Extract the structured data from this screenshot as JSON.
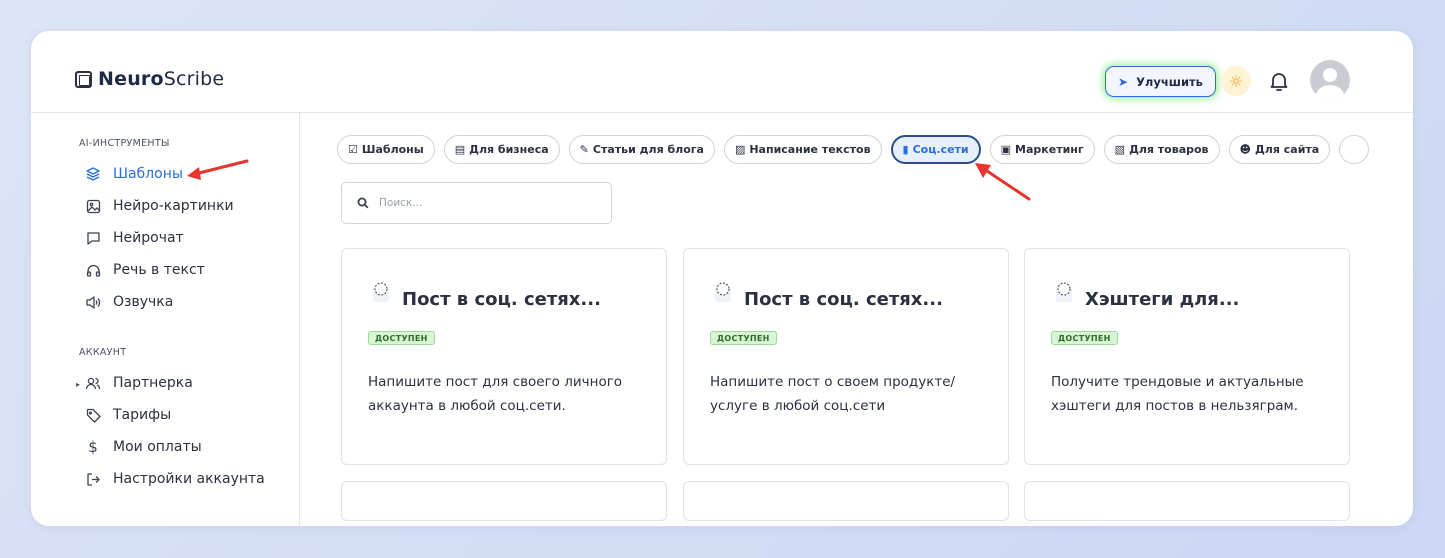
{
  "app": {
    "logo_bold": "Neuro",
    "logo_rest": "Scribe"
  },
  "header": {
    "upgrade_label": "Улучшить"
  },
  "sidebar": {
    "section_tools": "AI-ИНСТРУМЕНТЫ",
    "section_account": "АККАУНТ",
    "tools": [
      {
        "label": "Шаблоны",
        "icon": "layers-icon"
      },
      {
        "label": "Нейро-картинки",
        "icon": "image-icon"
      },
      {
        "label": "Нейрочат",
        "icon": "chat-icon"
      },
      {
        "label": "Речь в текст",
        "icon": "headphones-icon"
      },
      {
        "label": "Озвучка",
        "icon": "speaker-icon"
      }
    ],
    "account": [
      {
        "label": "Партнерка",
        "icon": "users-icon"
      },
      {
        "label": "Тарифы",
        "icon": "tag-icon"
      },
      {
        "label": "Мои оплаты",
        "icon": "dollar-icon"
      },
      {
        "label": "Настройки аккаунта",
        "icon": "logout-icon"
      }
    ]
  },
  "categories": [
    {
      "label": "Шаблоны",
      "icon": "checkbox-icon"
    },
    {
      "label": "Для бизнеса",
      "icon": "document-icon"
    },
    {
      "label": "Статьи для блога",
      "icon": "memo-icon"
    },
    {
      "label": "Написание текстов",
      "icon": "books-icon"
    },
    {
      "label": "Соц.сети",
      "icon": "phone-icon",
      "active": true
    },
    {
      "label": "Маркетинг",
      "icon": "laptop-icon"
    },
    {
      "label": "Для товаров",
      "icon": "ledger-icon"
    },
    {
      "label": "Для сайта",
      "icon": "robot-icon"
    }
  ],
  "search": {
    "placeholder": "Поиск..."
  },
  "cards": [
    {
      "title": "Пост в соц. сетях...",
      "badge": "ДОСТУПЕН",
      "description": "Напишите пост для своего личного аккаунта в любой соц.сети."
    },
    {
      "title": "Пост в соц. сетях...",
      "badge": "ДОСТУПЕН",
      "description": "Напишите пост о своем продукте/услуге в любой соц.сети"
    },
    {
      "title": "Хэштеги для...",
      "badge": "ДОСТУПЕН",
      "description": "Получите трендовые и актуальные хэштеги для постов в нельзяграм."
    }
  ],
  "colors": {
    "accent": "#2a6fdb",
    "badge_bg": "#d8f5d5",
    "annotation_arrow": "#e8332f"
  }
}
